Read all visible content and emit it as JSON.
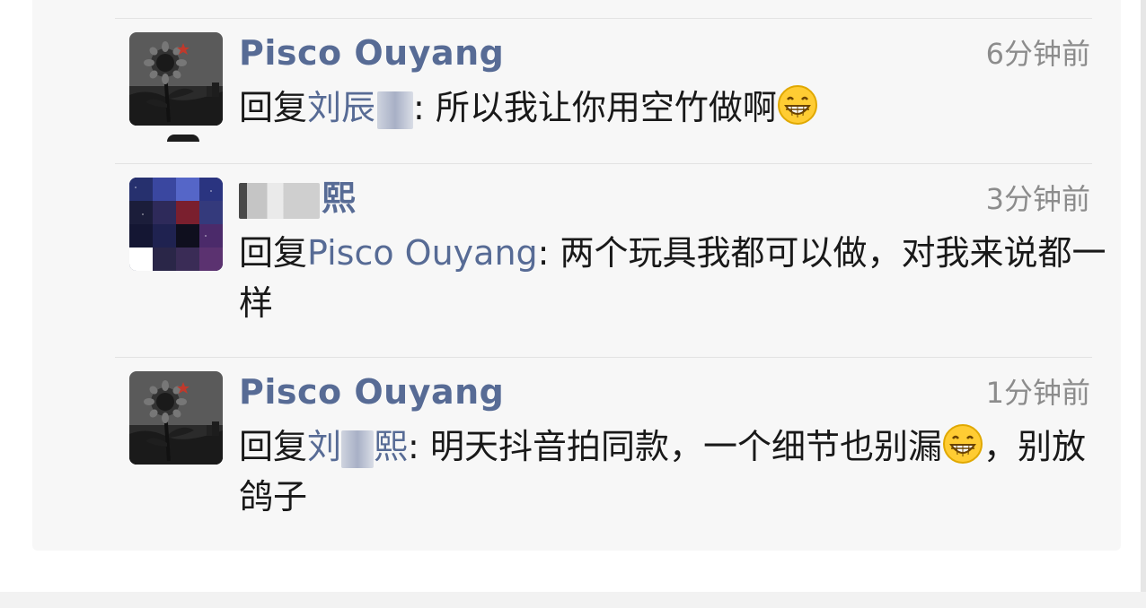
{
  "comments": [
    {
      "author": "Pisco Ouyang",
      "time": "6分钟前",
      "reply_prefix": "回复",
      "reply_to": "刘辰",
      "separator": ": ",
      "text": "所以我让你用空竹做啊",
      "trailing_emoji": "grinning-face-icon",
      "avatar": "sunflower-avatar"
    },
    {
      "author": "熙",
      "time": "3分钟前",
      "reply_prefix": "回复",
      "reply_to": "Pisco Ouyang",
      "separator": ": ",
      "text": "两个玩具我都可以做，对我来说都一样",
      "avatar": "pixelated-avatar"
    },
    {
      "author": "Pisco Ouyang",
      "time": "1分钟前",
      "reply_prefix": "回复",
      "reply_to_a": "刘",
      "reply_to_b": "熙",
      "separator": ": ",
      "text_before_emoji": "明天抖音拍同款，一个细节也别漏",
      "text_after_emoji": "，别放鸽子",
      "inline_emoji": "grinning-face-icon",
      "avatar": "sunflower-avatar"
    }
  ],
  "colors": {
    "name": "#576b95",
    "text": "#191919",
    "time": "#8c8c8c",
    "panel_bg": "#f7f7f7",
    "divider": "#e3e3e3"
  }
}
